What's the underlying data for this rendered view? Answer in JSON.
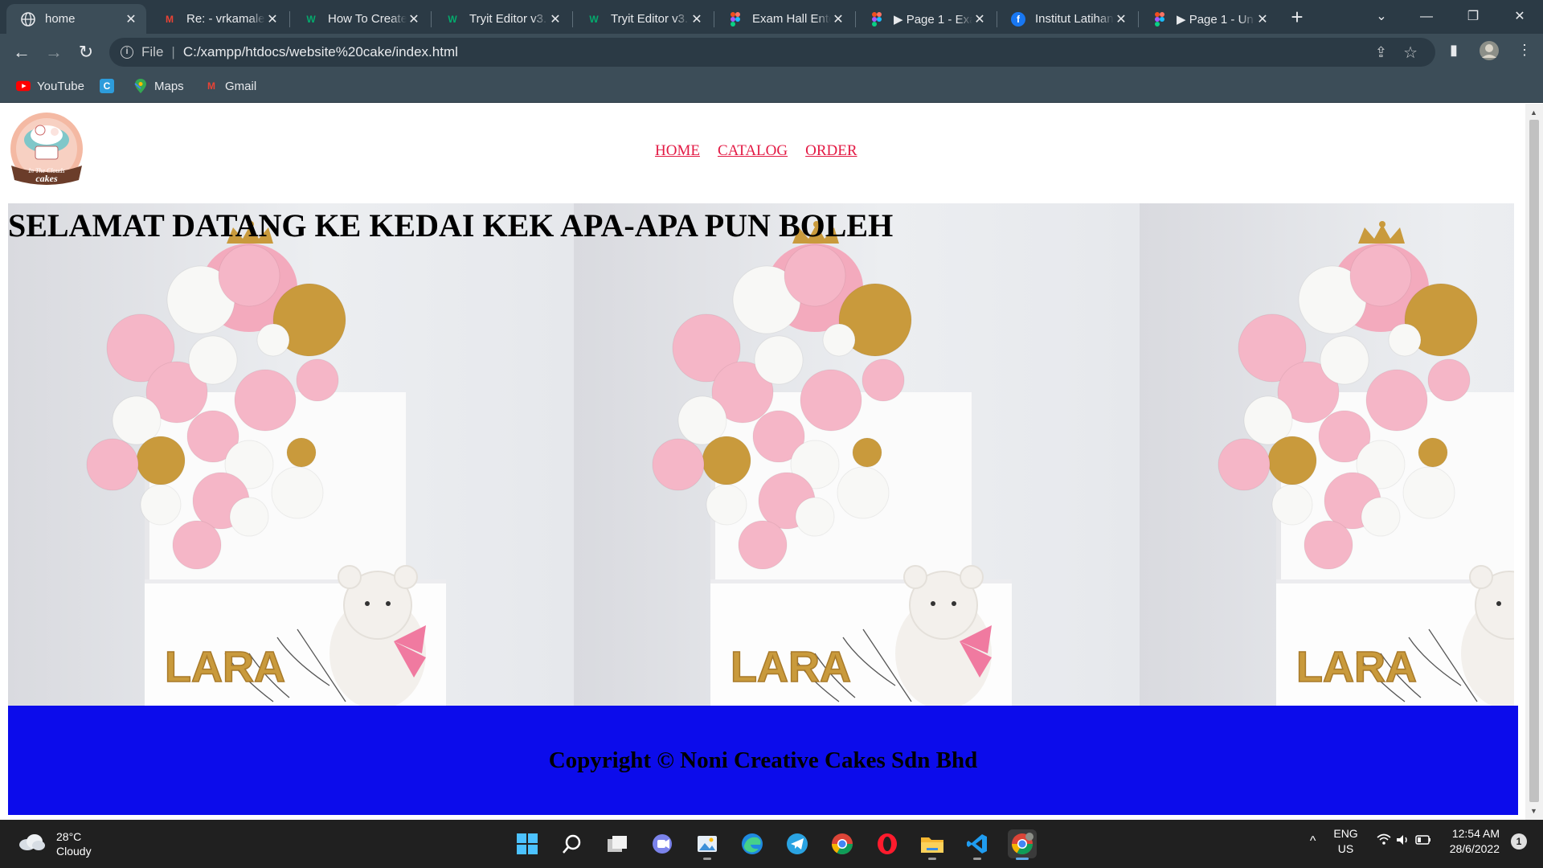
{
  "browser": {
    "tabs": [
      {
        "title": "home",
        "favicon": "globe-icon",
        "active": true
      },
      {
        "title": "Re: - vrkamalesh",
        "favicon": "gmail-icon"
      },
      {
        "title": "How To Create",
        "favicon": "w3schools-icon"
      },
      {
        "title": "Tryit Editor v3.",
        "favicon": "w3schools-icon"
      },
      {
        "title": "Tryit Editor v3.",
        "favicon": "w3schools-icon"
      },
      {
        "title": "Exam Hall Enter",
        "favicon": "figma-icon"
      },
      {
        "title": "▶ Page 1 - Exa",
        "favicon": "figma-icon"
      },
      {
        "title": "Institut Latihan",
        "favicon": "facebook-icon"
      },
      {
        "title": "▶ Page 1 - Un",
        "favicon": "figma-icon"
      }
    ],
    "address": {
      "scheme_label": "File",
      "url": "C:/xampp/htdocs/website%20cake/index.html"
    },
    "bookmarks": [
      {
        "label": "YouTube",
        "icon": "youtube-icon"
      },
      {
        "label": "",
        "icon": "c-app-icon"
      },
      {
        "label": "Maps",
        "icon": "maps-icon"
      },
      {
        "label": "Gmail",
        "icon": "gmail-icon"
      }
    ]
  },
  "page": {
    "logo_text_top": "In The Clouds",
    "logo_text_bottom": "cakes",
    "nav": [
      "HOME",
      "CATALOG",
      "ORDER"
    ],
    "hero_title": "SELAMAT DATANG KE KEDAI KEK APA-APA PUN BOLEH",
    "hero_image_name": "LARA",
    "footer": "Copyright © Noni Creative Cakes Sdn Bhd",
    "link_color": "#e31a44",
    "footer_color": "#0c0ceb"
  },
  "taskbar": {
    "weather": {
      "temp": "28°C",
      "condition": "Cloudy"
    },
    "apps": [
      "windows-start-icon",
      "search-icon",
      "task-view-icon",
      "teams-icon",
      "photos-icon",
      "edge-icon",
      "telegram-icon",
      "chrome-icon",
      "opera-icon",
      "file-explorer-icon",
      "vscode-icon",
      "chrome-profile-icon"
    ],
    "lang": {
      "line1": "ENG",
      "line2": "US"
    },
    "clock": {
      "time": "12:54 AM",
      "date": "28/6/2022"
    },
    "notifications": "1"
  }
}
